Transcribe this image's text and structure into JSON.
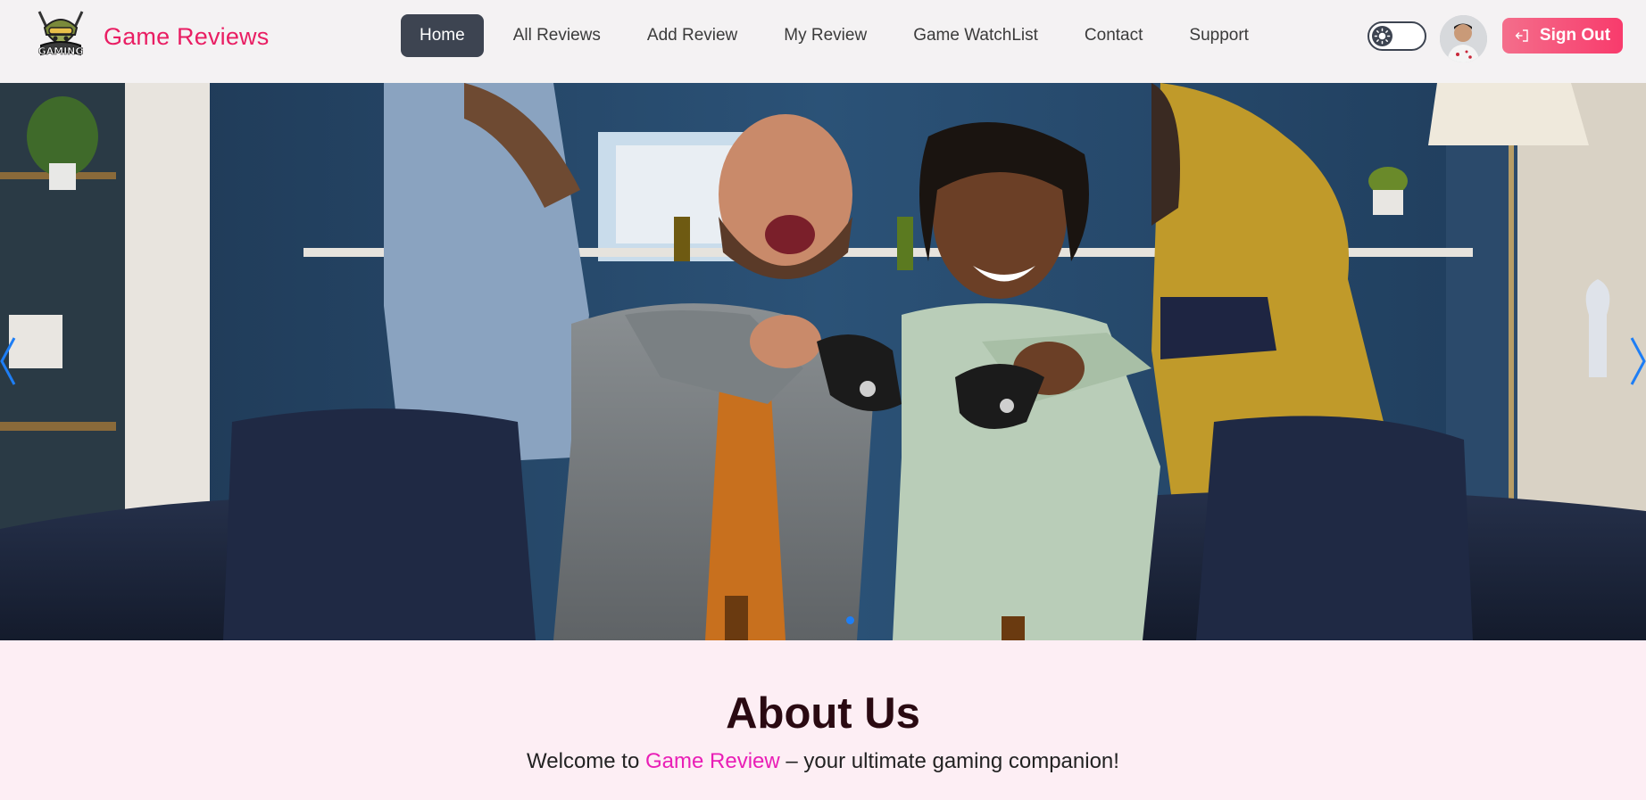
{
  "brand": {
    "name": "Game Reviews",
    "logo_text": "GAMING"
  },
  "nav": {
    "items": [
      {
        "label": "Home",
        "active": true
      },
      {
        "label": "All Reviews",
        "active": false
      },
      {
        "label": "Add Review",
        "active": false
      },
      {
        "label": "My Review",
        "active": false
      },
      {
        "label": "Game WatchList",
        "active": false
      },
      {
        "label": "Contact",
        "active": false
      },
      {
        "label": "Support",
        "active": false
      }
    ]
  },
  "header": {
    "theme_toggle_icon": "sun-icon",
    "avatar_icon": "user-avatar",
    "signout_label": "Sign Out",
    "signout_icon": "logout-icon"
  },
  "carousel": {
    "prev_icon": "chevron-left-icon",
    "next_icon": "chevron-right-icon",
    "active_slide": 1,
    "slide_count": 1
  },
  "about": {
    "title": "About Us",
    "text_prefix": "Welcome to",
    "text_highlight": "Game Review",
    "text_suffix": "– your ultimate gaming companion!"
  },
  "colors": {
    "brand": "#e91e63",
    "nav_active_bg": "#3d4451",
    "signout_start": "#f46e8b",
    "signout_end": "#f83b6c",
    "carousel_accent": "#1e7ef5",
    "about_bg": "#fdeef4",
    "highlight": "#e91eb6"
  }
}
